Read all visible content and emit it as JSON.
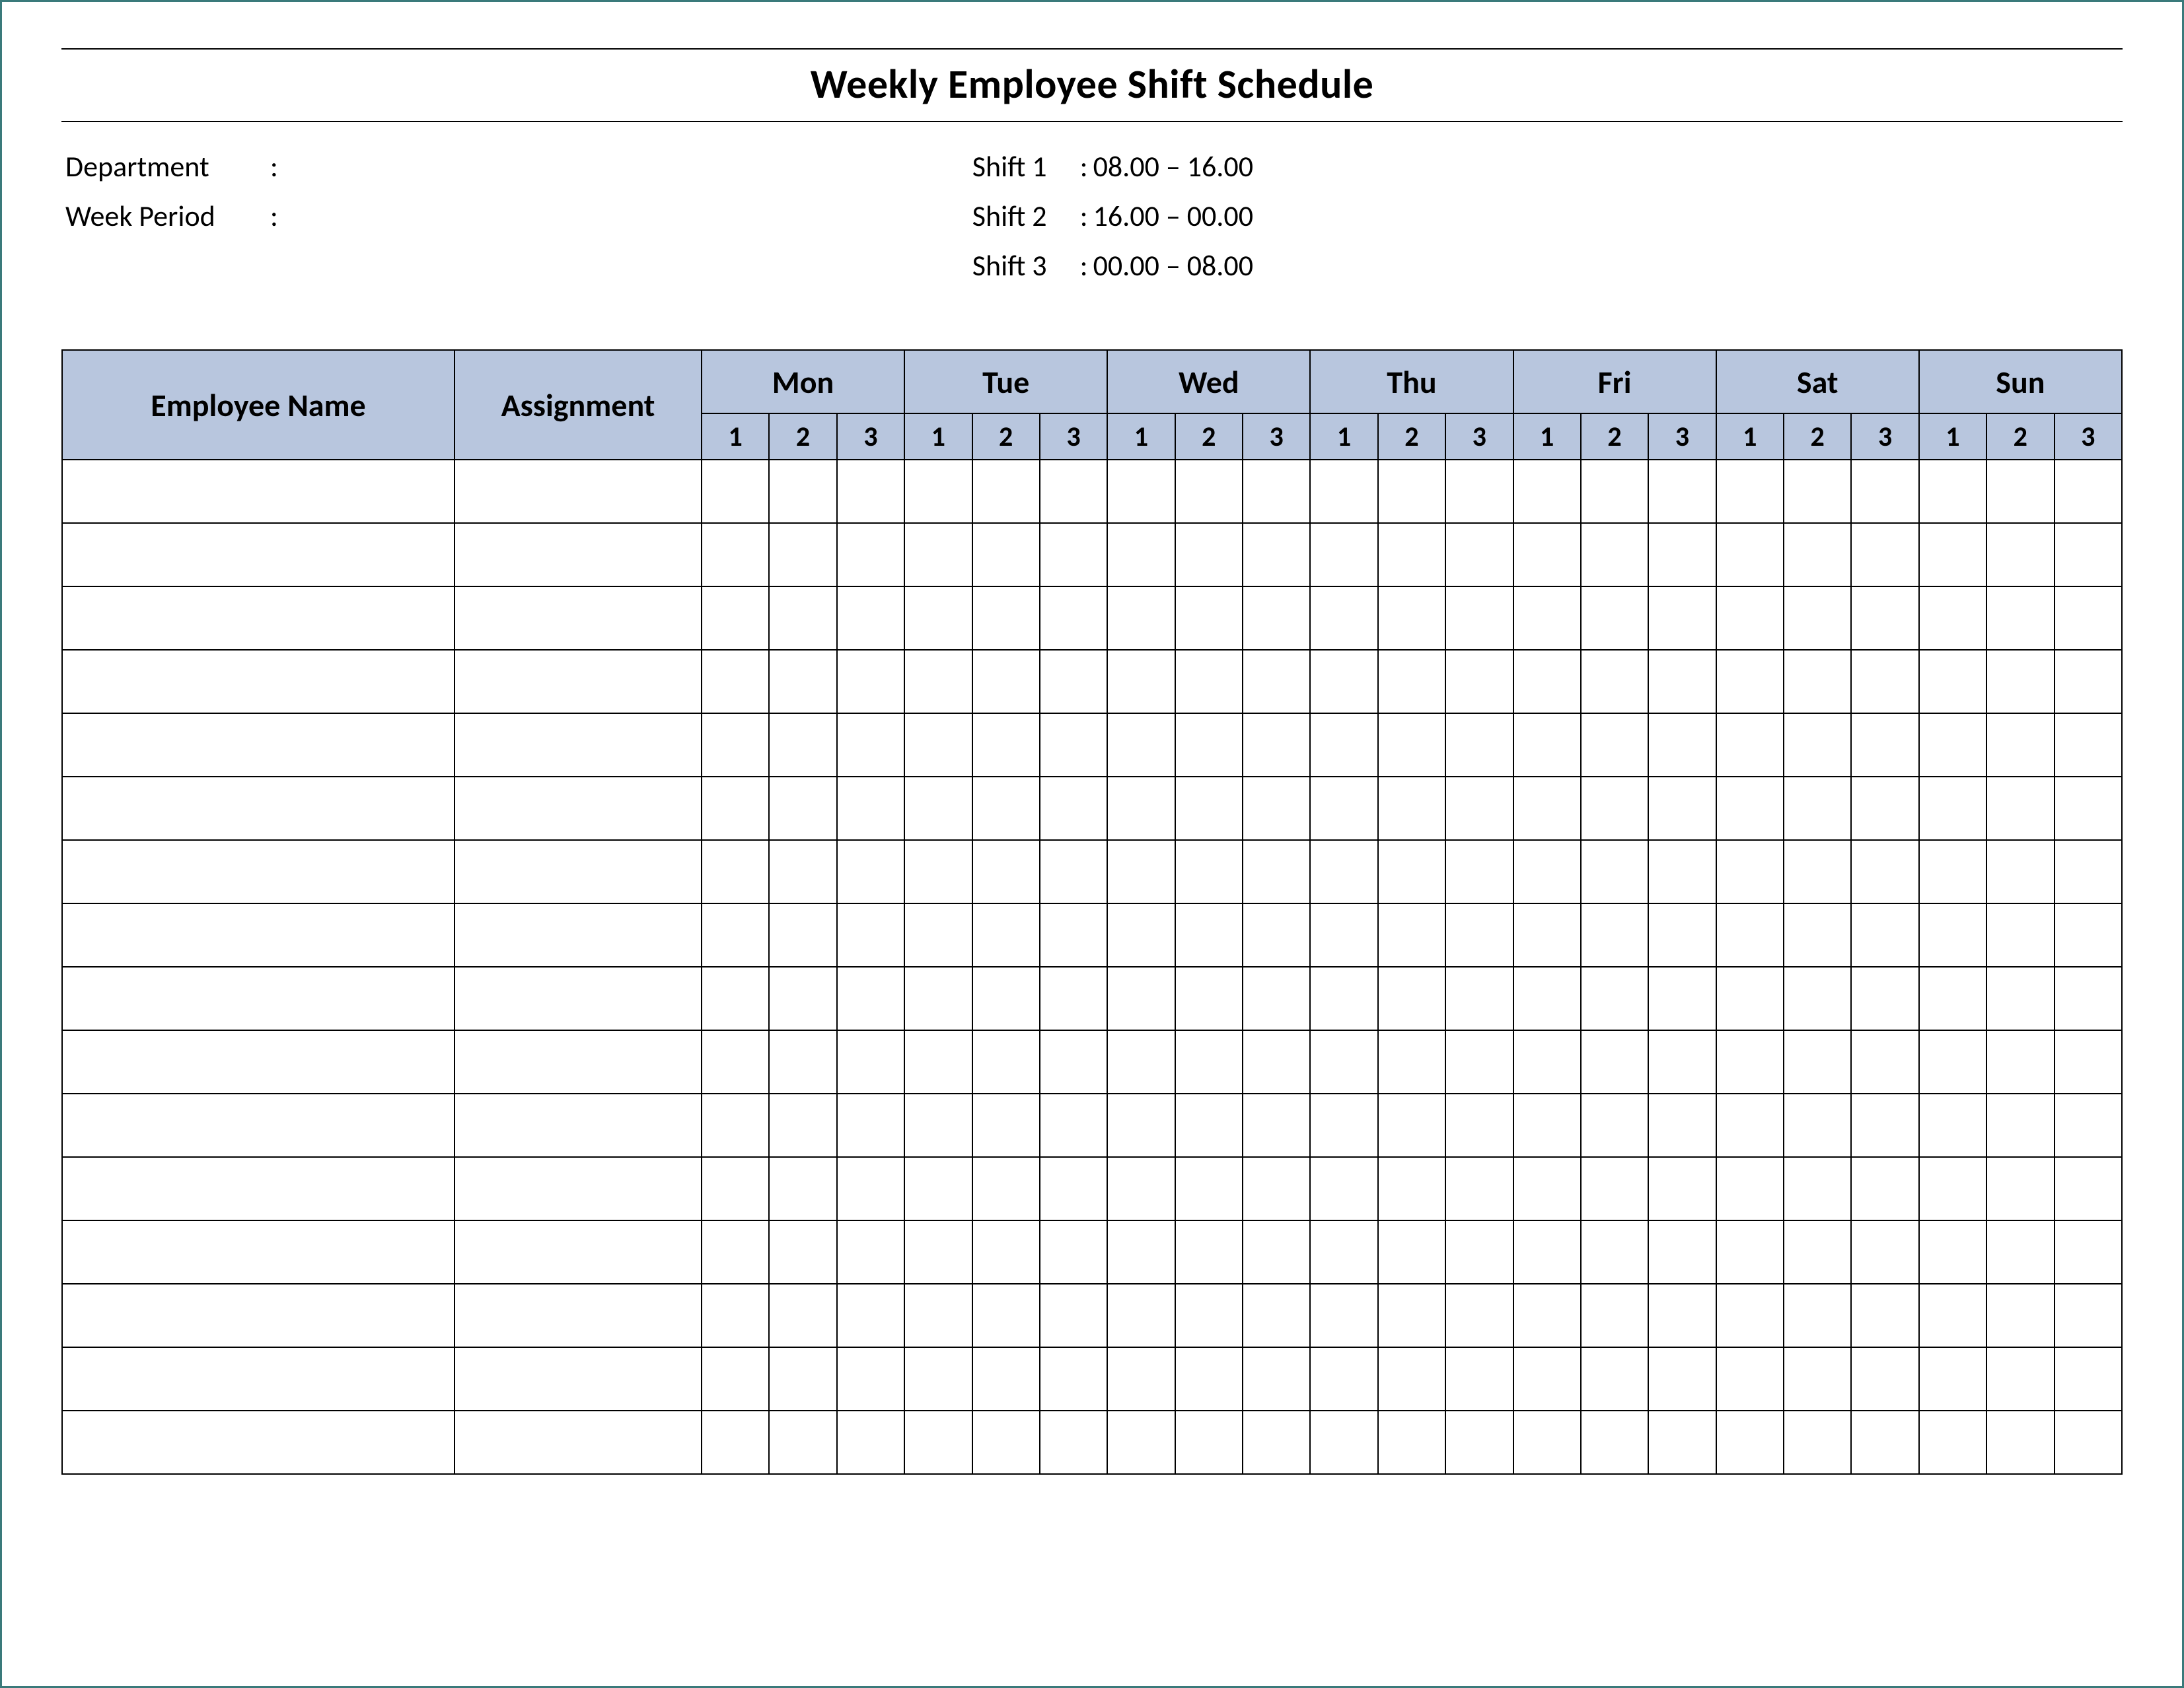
{
  "title": "Weekly Employee Shift Schedule",
  "meta": {
    "department_label": "Department",
    "department_value": "",
    "week_period_label": "Week  Period",
    "week_period_value": "",
    "shifts": [
      {
        "label": "Shift 1",
        "time": "08.00  – 16.00"
      },
      {
        "label": "Shift 2",
        "time": "16.00  – 00.00"
      },
      {
        "label": "Shift 3",
        "time": "00.00  – 08.00"
      }
    ]
  },
  "table": {
    "employee_header": "Employee Name",
    "assignment_header": "Assignment",
    "days": [
      "Mon",
      "Tue",
      "Wed",
      "Thu",
      "Fri",
      "Sat",
      "Sun"
    ],
    "sub_shifts": [
      "1",
      "2",
      "3"
    ],
    "row_count": 16
  }
}
